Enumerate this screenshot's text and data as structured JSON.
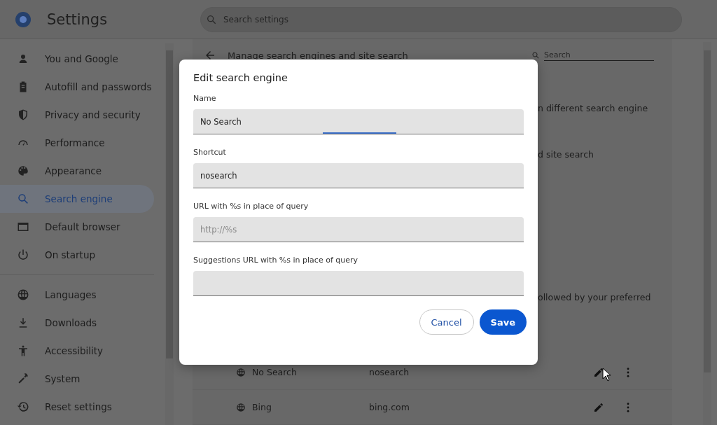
{
  "app": {
    "title": "Settings",
    "search": {
      "placeholder": "Search settings"
    }
  },
  "sidebar": {
    "groups": [
      [
        {
          "label": "You and Google",
          "selected": false
        },
        {
          "label": "Autofill and passwords",
          "selected": false
        },
        {
          "label": "Privacy and security",
          "selected": false
        },
        {
          "label": "Performance",
          "selected": false
        },
        {
          "label": "Appearance",
          "selected": false
        },
        {
          "label": "Search engine",
          "selected": true
        },
        {
          "label": "Default browser",
          "selected": false
        },
        {
          "label": "On startup",
          "selected": false
        }
      ],
      [
        {
          "label": "Languages",
          "selected": false
        },
        {
          "label": "Downloads",
          "selected": false
        },
        {
          "label": "Accessibility",
          "selected": false
        },
        {
          "label": "System",
          "selected": false
        },
        {
          "label": "Reset settings",
          "selected": false
        }
      ]
    ]
  },
  "page": {
    "title": "Manage search engines and site search",
    "search": {
      "placeholder": "Search"
    },
    "text_fragments": [
      "n different search engine",
      "d site search",
      "ollowed by your preferred"
    ],
    "engines": [
      {
        "name": "No Search",
        "shortcut": "nosearch"
      },
      {
        "name": "Bing",
        "shortcut": "bing.com"
      }
    ]
  },
  "dialog": {
    "title": "Edit search engine",
    "fields": [
      {
        "label": "Name",
        "value": "No Search",
        "focused": true
      },
      {
        "label": "Shortcut",
        "value": "nosearch",
        "focused": false
      },
      {
        "label": "URL with %s in place of query",
        "placeholder": "http://%s",
        "focused": false
      },
      {
        "label": "Suggestions URL with %s in place of query",
        "focused": false
      }
    ],
    "buttons": [
      {
        "label": "Cancel",
        "kind": "secondary"
      },
      {
        "label": "Save",
        "kind": "primary"
      }
    ]
  }
}
